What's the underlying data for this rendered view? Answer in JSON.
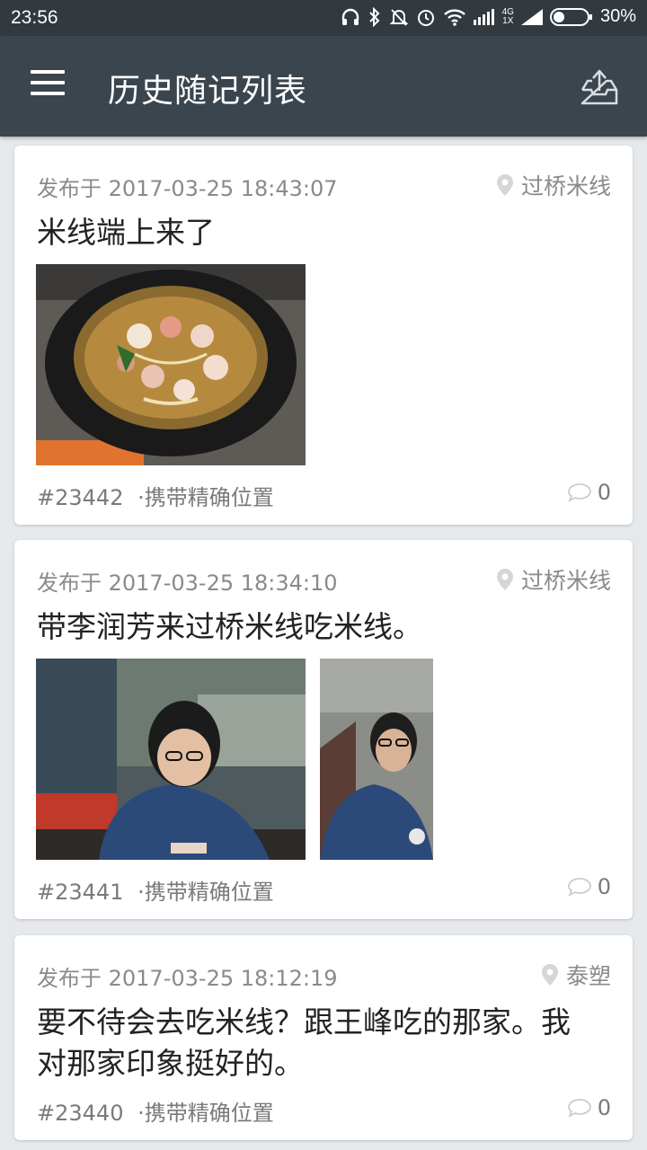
{
  "status_bar": {
    "time": "23:56",
    "network_label": "4G",
    "sim_label": "1X",
    "battery": "30%"
  },
  "app_bar": {
    "title": "历史随记列表",
    "menu_icon": "hamburger-menu-icon",
    "share_icon": "upload-tray-icon"
  },
  "posts": [
    {
      "published": "发布于 2017-03-25 18:43:07",
      "location": "过桥米线",
      "text": "米线端上来了",
      "id": "#23442",
      "precise_location": "·携带精确位置",
      "comments": "0"
    },
    {
      "published": "发布于 2017-03-25 18:34:10",
      "location": "过桥米线",
      "text": "带李润芳来过桥米线吃米线。",
      "id": "#23441",
      "precise_location": "·携带精确位置",
      "comments": "0"
    },
    {
      "published": "发布于 2017-03-25 18:12:19",
      "location": "泰塑",
      "text": "要不待会去吃米线？跟王峰吃的那家。我对那家印象挺好的。",
      "id": "#23440",
      "precise_location": "·携带精确位置",
      "comments": "0"
    }
  ],
  "colors": {
    "status_bar": "#32393f",
    "app_bar": "#3b454d",
    "background": "#e6e9ec",
    "card": "#ffffff",
    "meta_text": "#8a8a8a"
  }
}
